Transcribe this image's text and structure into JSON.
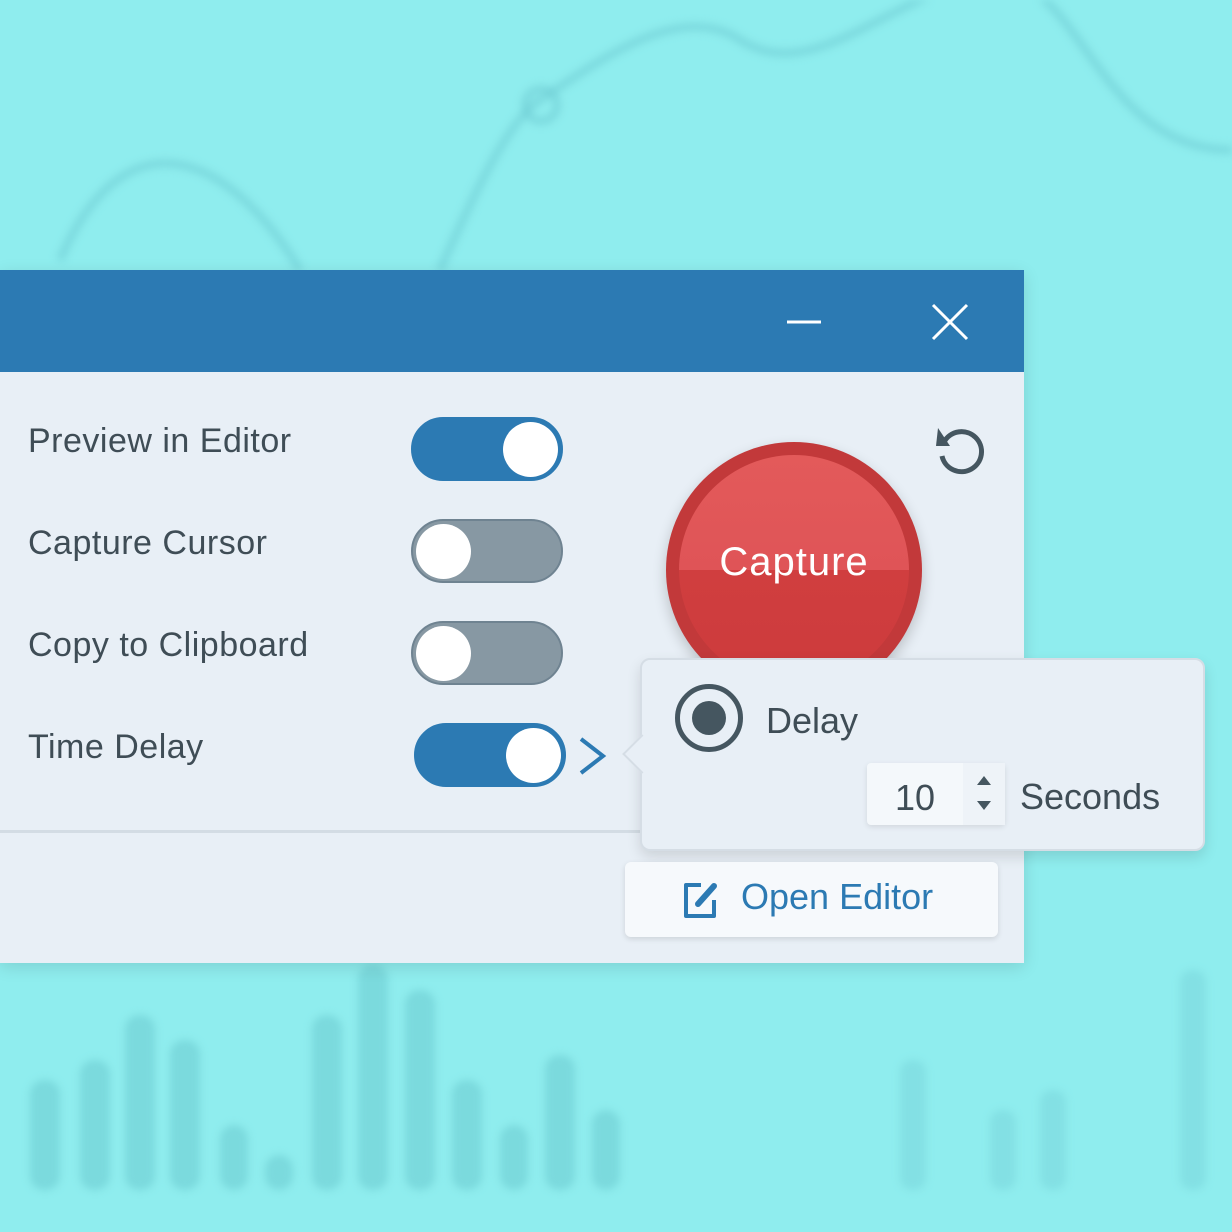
{
  "window": {
    "minimize_icon": "minus-icon",
    "close_icon": "close-icon"
  },
  "options": [
    {
      "label": "Preview in Editor",
      "enabled": true
    },
    {
      "label": "Capture Cursor",
      "enabled": false
    },
    {
      "label": "Copy to Clipboard",
      "enabled": false
    },
    {
      "label": "Time Delay",
      "enabled": true
    }
  ],
  "capture": {
    "label": "Capture",
    "color": "#cd3b3c"
  },
  "reset_icon": "reset-icon",
  "delay_popover": {
    "radio_label": "Delay",
    "selected": true,
    "value": "10",
    "unit": "Seconds"
  },
  "open_editor": {
    "label": "Open Editor",
    "icon": "edit-icon"
  },
  "colors": {
    "accent": "#2c7ab3",
    "background": "#8fedee",
    "panel": "#e8eff6"
  }
}
